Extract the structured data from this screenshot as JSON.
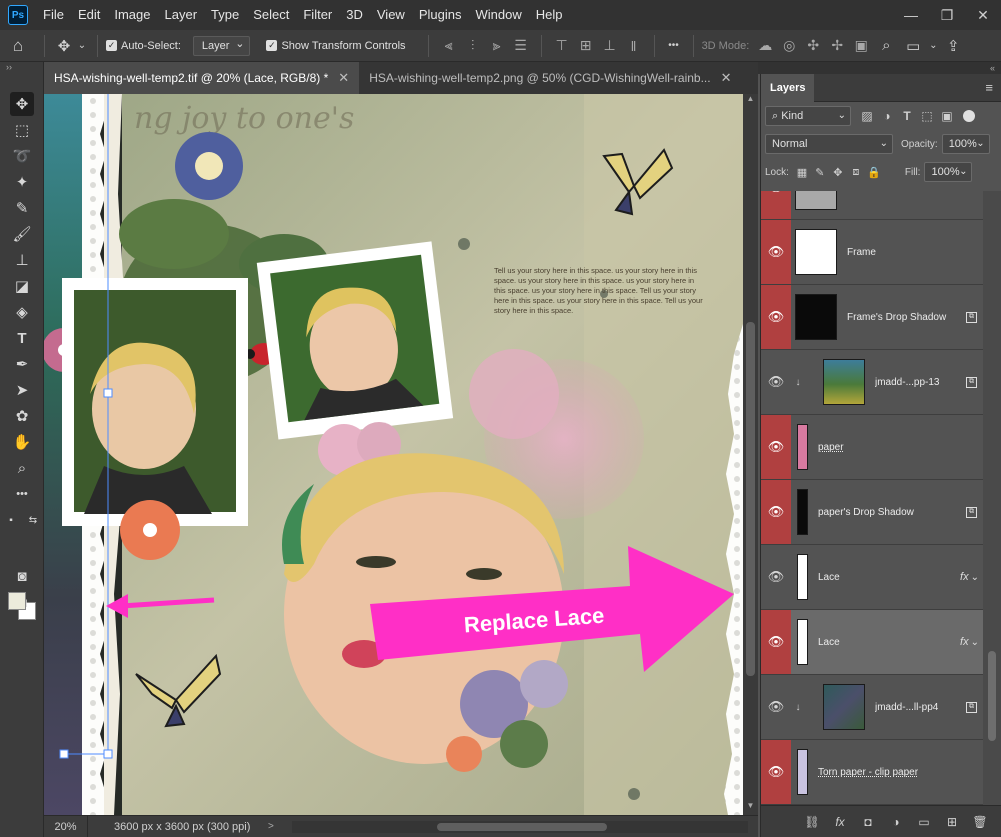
{
  "app": {
    "logo": "Ps",
    "menu": [
      "File",
      "Edit",
      "Image",
      "Layer",
      "Type",
      "Select",
      "Filter",
      "3D",
      "View",
      "Plugins",
      "Window",
      "Help"
    ],
    "window_controls": [
      "—",
      "❐",
      "✕"
    ]
  },
  "options_bar": {
    "auto_select_label": "Auto-Select:",
    "auto_select_target": "Layer",
    "show_transform_label": "Show Transform Controls",
    "three_d_mode_label": "3D Mode:",
    "more_label": "•••"
  },
  "tabs": [
    {
      "label": "HSA-wishing-well-temp2.tif @ 20% (Lace, RGB/8) *",
      "active": true
    },
    {
      "label": "HSA-wishing-well-temp2.png @ 50% (CGD-WishingWell-rainb...",
      "active": false
    }
  ],
  "canvas": {
    "script_text": "ng joy to one's ",
    "story_text": "Tell us your story here in this space. us your story here in this space. us your story here in this space. us your story here in this space. us your story here in this space. Tell us your story here in this space. us your story here in this space. Tell us your story here in this space.",
    "callout_text": "Replace Lace",
    "callout_color": "#ff2fc6"
  },
  "status": {
    "zoom": "20%",
    "doc_info": "3600 px x 3600 px (300 ppi)",
    "arrow": ">"
  },
  "layers_panel": {
    "title": "Layers",
    "filter_kind": "Kind",
    "blend_mode": "Normal",
    "opacity_label": "Opacity:",
    "opacity_value": "100%",
    "lock_label": "Lock:",
    "fill_label": "Fill:",
    "fill_value": "100%",
    "layers": [
      {
        "name": "",
        "visible_marker": true,
        "thumb": "#a9a9a9",
        "clipped": false,
        "badge": "",
        "fx": false,
        "selected": false
      },
      {
        "name": "Frame",
        "visible_marker": true,
        "thumb": "#ffffff",
        "clipped": false,
        "badge": "",
        "fx": false,
        "selected": false
      },
      {
        "name": "Frame's Drop Shadow",
        "visible_marker": true,
        "thumb": "#0a0a0a",
        "clipped": false,
        "badge": "smart",
        "fx": false,
        "selected": false
      },
      {
        "name": "jmadd-...pp-13",
        "visible_marker": false,
        "thumb": "gradient",
        "clipped": true,
        "badge": "smart",
        "fx": false,
        "selected": false
      },
      {
        "name": "paper",
        "visible_marker": true,
        "thumb": "#d87aa0",
        "clipped": false,
        "badge": "",
        "fx": false,
        "selected": false
      },
      {
        "name": "paper's Drop Shadow",
        "visible_marker": true,
        "thumb": "#0a0a0a",
        "clipped": false,
        "badge": "smart",
        "fx": false,
        "selected": false
      },
      {
        "name": "Lace",
        "visible_marker": false,
        "thumb": "#ffffff",
        "clipped": false,
        "badge": "",
        "fx": true,
        "selected": false
      },
      {
        "name": "Lace",
        "visible_marker": true,
        "thumb": "#ffffff",
        "clipped": false,
        "badge": "",
        "fx": true,
        "selected": true
      },
      {
        "name": "jmadd-...ll-pp4",
        "visible_marker": false,
        "thumb": "texture",
        "clipped": true,
        "badge": "smart",
        "fx": false,
        "selected": false
      },
      {
        "name": "Torn paper - clip paper",
        "visible_marker": true,
        "thumb": "#c9c3e0",
        "clipped": false,
        "badge": "",
        "fx": false,
        "selected": false
      }
    ],
    "fx_label": "fx",
    "eye_glyph": "👁"
  }
}
